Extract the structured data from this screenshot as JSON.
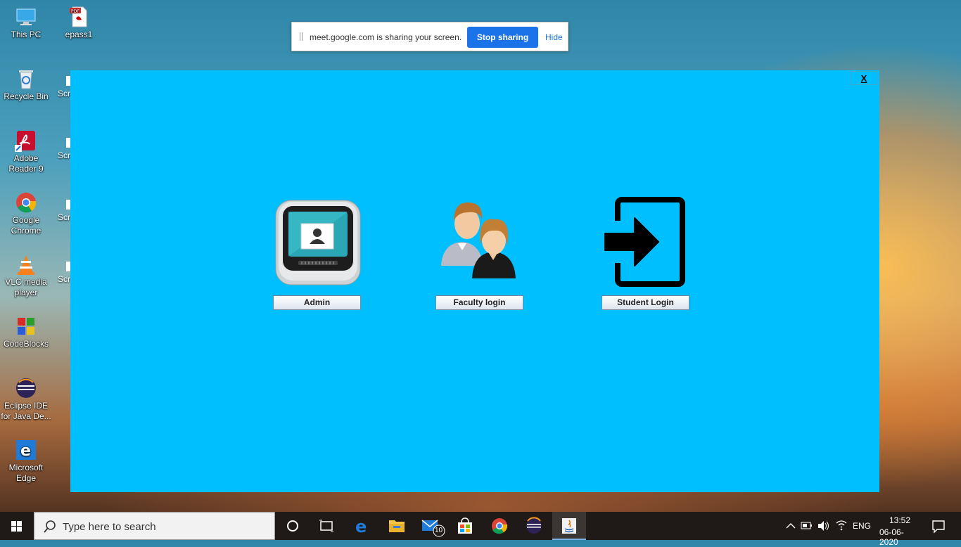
{
  "desktop": {
    "icons": [
      {
        "label": "This PC"
      },
      {
        "label": "epass1"
      },
      {
        "label": "Recycle Bin"
      },
      {
        "label": "Adobe Reader 9"
      },
      {
        "label": "Google Chrome"
      },
      {
        "label": "VLC media player"
      },
      {
        "label": "CodeBlocks"
      },
      {
        "label": "Eclipse IDE for Java De..."
      },
      {
        "label": "Microsoft Edge"
      }
    ],
    "partial_label": "Scr"
  },
  "sharebar": {
    "message": "meet.google.com is sharing your screen.",
    "stop_label": "Stop sharing",
    "hide_label": "Hide"
  },
  "app": {
    "close_label": "X",
    "buttons": {
      "admin": "Admin",
      "faculty": "Faculty login",
      "student": "Student Login"
    },
    "background_color": "#00bfff"
  },
  "taskbar": {
    "search_placeholder": "Type here to search",
    "mail_badge": "10",
    "language": "ENG",
    "time": "13:52",
    "date": "06-06-2020"
  }
}
